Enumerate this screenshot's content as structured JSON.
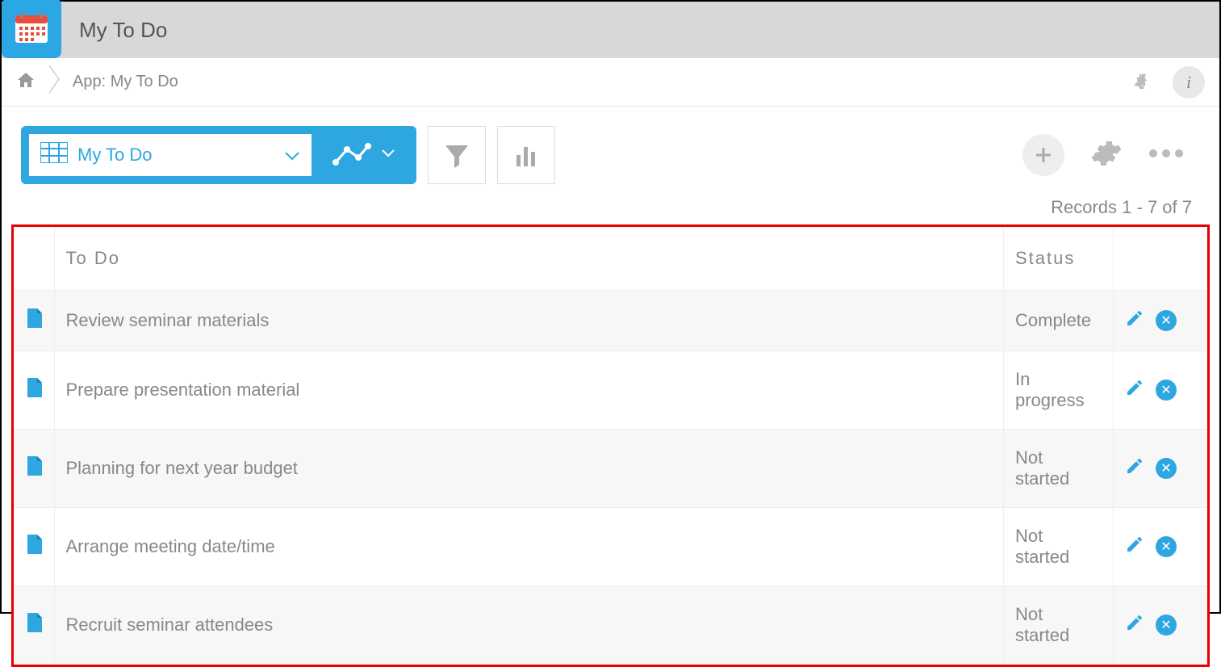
{
  "header": {
    "title": "My To Do"
  },
  "breadcrumb": {
    "text": "App: My To Do"
  },
  "toolbar": {
    "view_label": "My To Do"
  },
  "records_count": "Records 1 - 7 of 7",
  "table": {
    "headers": {
      "todo": "To Do",
      "status": "Status"
    },
    "rows": [
      {
        "todo": "Review seminar materials",
        "status": "Complete"
      },
      {
        "todo": "Prepare presentation material",
        "status": "In progress"
      },
      {
        "todo": "Planning for next year budget",
        "status": "Not started"
      },
      {
        "todo": "Arrange meeting date/time",
        "status": "Not started"
      },
      {
        "todo": "Recruit seminar attendees",
        "status": "Not started"
      }
    ]
  }
}
